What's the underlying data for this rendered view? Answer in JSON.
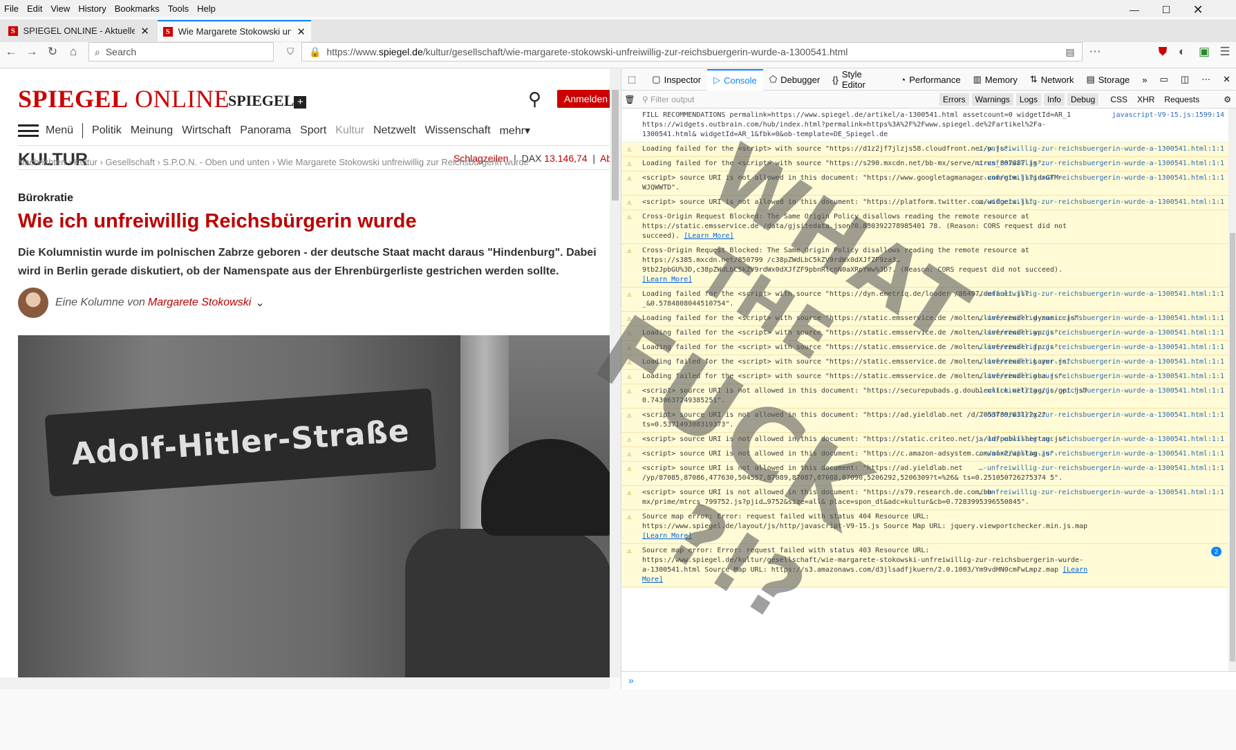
{
  "menu": [
    "File",
    "Edit",
    "View",
    "History",
    "Bookmarks",
    "Tools",
    "Help"
  ],
  "tabs": [
    {
      "title": "SPIEGEL ONLINE - Aktuelle Na",
      "active": false
    },
    {
      "title": "Wie Margarete Stokowski unfre",
      "active": true
    }
  ],
  "search_placeholder": "Search",
  "url": {
    "prefix": "https://www.",
    "domain": "spiegel.de",
    "path": "/kultur/gesellschaft/wie-margarete-stokowski-unfreiwillig-zur-reichsbuergerin-wurde-a-1300541.html"
  },
  "page": {
    "logo_a": "SPIEGEL",
    "logo_b": "ONLINE",
    "plus": "SPIEGEL",
    "anmelden": "Anmelden",
    "nav": [
      "Menü",
      "Politik",
      "Meinung",
      "Wirtschaft",
      "Panorama",
      "Sport",
      "Kultur",
      "Netzwelt",
      "Wissenschaft",
      "mehr"
    ],
    "section": "KULTUR",
    "schlagzeilen": "Schlagzeilen",
    "dax_label": "DAX",
    "dax_value": "13.146,74",
    "abo": "Abo",
    "breadcrumb": "Nachrichten › Kultur › Gesellschaft › S.P.O.N. - Oben und unten › Wie Margarete Stokowski unfreiwillig zur Reichsbürgerin wurde",
    "kicker": "Bürokratie",
    "headline": "Wie ich unfreiwillig Reichsbürgerin wurde",
    "teaser": "Die Kolumnistin wurde im polnischen Zabrze geboren - der deutsche Staat macht daraus \"Hindenburg\". Dabei wird in Berlin gerade diskutiert, ob der Namenspate aus der Ehrenbürgerliste gestrichen werden sollte.",
    "author_prefix": "Eine Kolumne von",
    "author": "Margarete Stokowski",
    "photo_sign": "Adolf-Hitler-Straße"
  },
  "devtools": {
    "tabs": [
      "Inspector",
      "Console",
      "Debugger",
      "Style Editor",
      "Performance",
      "Memory",
      "Network",
      "Storage"
    ],
    "filter_placeholder": "Filter output",
    "filters": [
      "Errors",
      "Warnings",
      "Logs",
      "Info",
      "Debug",
      "CSS",
      "XHR",
      "Requests"
    ],
    "messages": [
      {
        "t": "log",
        "text": "FILL RECOMMENDATIONS permalink=https://www.spiegel.de/artikel/a-1300541.html assetcount=0 widgetId=AR_1 https://widgets.outbrain.com/hub/index.html?permalink=https%3A%2F%2Fwww.spiegel.de%2Fartikel%2Fa-1300541.html& widgetId=AR_1&fbk=0&ob-template=DE_Spiegel.de",
        "src": "javascript-V9-15.js:1599:14"
      },
      {
        "t": "warn",
        "text": "Loading failed for the <script> with source \"https://d1z2jf7jlzjs58.cloudfront.net/p.js\".",
        "src": "…-unfreiwillig-zur-reichsbuergerin-wurde-a-1300541.html:1:1"
      },
      {
        "t": "warn",
        "text": "Loading failed for the <script> with source \"https://s290.mxcdn.net/bb-mx/serve/mtrcs_897887.js\".",
        "src": "…-unfreiwillig-zur-reichsbuergerin-wurde-a-1300541.html:1:1"
      },
      {
        "t": "warn",
        "text": "<script> source URI is not allowed in this document: \"https://www.googletagmanager.com/gtm.js?id=GTM-WJQWWTD\".",
        "src": "…-unfreiwillig-zur-reichsbuergerin-wurde-a-1300541.html:1:1"
      },
      {
        "t": "warn",
        "text": "<script> source URI is not allowed in this document: \"https://platform.twitter.com/widgets.js\".",
        "src": "…-unfreiwillig-zur-reichsbuergerin-wurde-a-1300541.html:1:1"
      },
      {
        "t": "warn",
        "text": "Cross-Origin Request Blocked: The Same Origin Policy disallows reading the remote resource at https://static.emsservice.de /data/gjsitedata.json?0.830392278985401 78. (Reason: CORS request did not succeed).",
        "lm": "[Learn More]",
        "src": ""
      },
      {
        "t": "warn",
        "text": "Cross-Origin Request Blocked: The Same Origin Policy disallows reading the remote resource at https://s385.mxcdn.net/850799 /c38pZWdLbC5kZV9rdWx0dXJfZF9za3…9tb2JpbGU%3D,c38pZWdLbC5kZV9rdWx0dXJfZF9pbnRlcnN0aXRpYWw%3D?. (Reason: CORS request did not succeed).",
        "lm": "[Learn More]",
        "src": ""
      },
      {
        "t": "warn",
        "text": "Loading failed for the <script> with source \"https://dyn.emetriq.de/loader /86497/default.js?_&0.5784808044510754\".",
        "src": "…-unfreiwillig-zur-reichsbuergerin-wurde-a-1300541.html:1:1"
      },
      {
        "t": "warn",
        "text": "Loading failed for the <script> with source \"https://static.emsservice.de /molten/live/render.dynamic.js\".",
        "src": "…-unfreiwillig-zur-reichsbuergerin-wurde-a-1300541.html:1:1"
      },
      {
        "t": "warn",
        "text": "Loading failed for the <script> with source \"https://static.emsservice.de /molten/live/render.wp.js\".",
        "src": "…-unfreiwillig-zur-reichsbuergerin-wurde-a-1300541.html:1:1"
      },
      {
        "t": "warn",
        "text": "Loading failed for the <script> with source \"https://static.emsservice.de /molten/live/render.fp.js\".",
        "src": "…-unfreiwillig-zur-reichsbuergerin-wurde-a-1300541.html:1:1"
      },
      {
        "t": "warn",
        "text": "Loading failed for the <script> with source \"https://static.emsservice.de /molten/live/render.Layer.js\".",
        "src": "…-unfreiwillig-zur-reichsbuergerin-wurde-a-1300541.html:1:1"
      },
      {
        "t": "warn",
        "text": "Loading failed for the <script> with source \"https://static.emsservice.de /molten/live/render.oba.js\".",
        "src": "…-unfreiwillig-zur-reichsbuergerin-wurde-a-1300541.html:1:1"
      },
      {
        "t": "warn",
        "text": "<script> source URI is not allowed in this document: \"https://securepubads.g.doubleclick.net/tag/js/gpt.js?0.7430637249385251\".",
        "src": "…-unfreiwillig-zur-reichsbuergerin-wurde-a-1300541.html:1:1"
      },
      {
        "t": "warn",
        "text": "<script> source URI is not allowed in this document: \"https://ad.yieldlab.net /d/7053789/631/2x2?ts=0.537149308319373\".",
        "src": "…-unfreiwillig-zur-reichsbuergerin-wurde-a-1300541.html:1:1"
      },
      {
        "t": "warn",
        "text": "<script> source URI is not allowed in this document: \"https://static.criteo.net/js/ld/publishertag.js\".",
        "src": "…-unfreiwillig-zur-reichsbuergerin-wurde-a-1300541.html:1:1"
      },
      {
        "t": "warn",
        "text": "<script> source URI is not allowed in this document: \"https://c.amazon-adsystem.com/aax2/apstag.js\".",
        "src": "…-unfreiwillig-zur-reichsbuergerin-wurde-a-1300541.html:1:1"
      },
      {
        "t": "warn",
        "text": "<script> source URI is not allowed in this document: \"https://ad.yieldlab.net /yp/87085,87086,477630,504557,87089,87087,87088,87090,5206292,5206309?t=%26& ts=0.251050726275374 5\".",
        "src": "…-unfreiwillig-zur-reichsbuergerin-wurde-a-1300541.html:1:1"
      },
      {
        "t": "warn",
        "text": "<script> source URI is not allowed in this document: \"https://s79.research.de.com/bb-mx/prime/mtrcs_799752.js?pjid…9752&size=all& place=spon_dt&adc=kultur&cb=0.7283995396550845\".",
        "src": "…-unfreiwillig-zur-reichsbuergerin-wurde-a-1300541.html:1:1"
      },
      {
        "t": "warn",
        "text": "Source map error: Error: request failed with status 404 Resource URL: https://www.spiegel.de/layout/js/http/javascript-V9-15.js Source Map URL: jquery.viewportchecker.min.js.map",
        "lm": "[Learn More]",
        "src": ""
      },
      {
        "t": "warn",
        "text": "Source map error: Error: request failed with status 403 Resource URL: https://www.spiegel.de/kultur/gesellschaft/wie-margarete-stokowski-unfreiwillig-zur-reichsbuergerin-wurde-a-1300541.html Source Map URL: https://s3.amazonaws.com/d3jlsadfjkuern/2.0.1003/Ym9vdHN0cmFwLmpz.map",
        "lm": "[Learn More]",
        "src": "",
        "badge": "2"
      }
    ],
    "prompt": "»"
  },
  "overlay": {
    "w1": "WHAT",
    "w2": "THE",
    "w3": "FUCK",
    "w4": "?!?"
  }
}
